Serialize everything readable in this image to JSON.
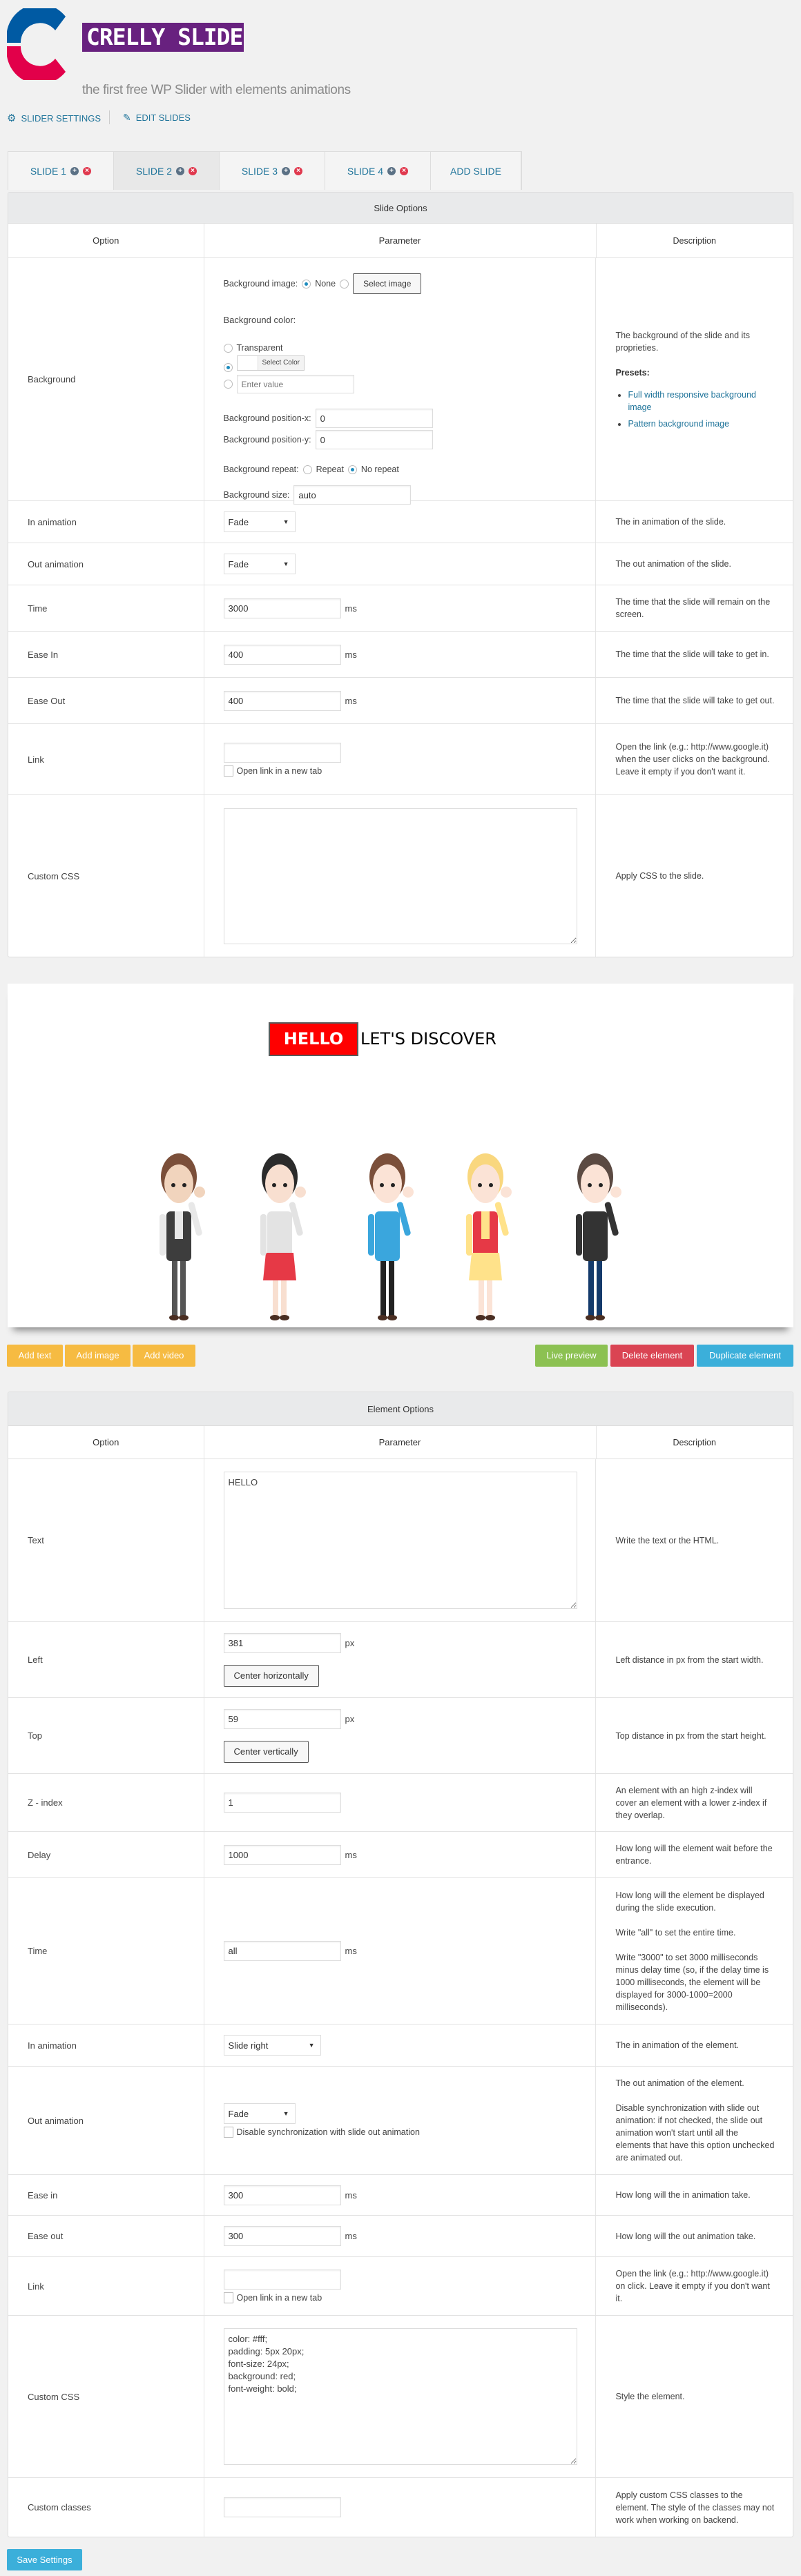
{
  "header": {
    "logo_text": "CRELLY SLIDER",
    "subtitle": "the first free WP Slider with elements animations"
  },
  "nav": {
    "slider_settings": "SLIDER SETTINGS",
    "edit_slides": "EDIT SLIDES"
  },
  "tabs": [
    {
      "label": "SLIDE 1",
      "active": false
    },
    {
      "label": "SLIDE 2",
      "active": true
    },
    {
      "label": "SLIDE 3",
      "active": false
    },
    {
      "label": "SLIDE 4",
      "active": false
    }
  ],
  "add_slide": "ADD SLIDE",
  "columns": {
    "option": "Option",
    "parameter": "Parameter",
    "description": "Description"
  },
  "slide_options": {
    "title": "Slide Options",
    "background": {
      "label": "Background",
      "bg_image_label": "Background image:",
      "none": "None",
      "select_image": "Select image",
      "bg_color_label": "Background color:",
      "transparent": "Transparent",
      "select_color": "Select Color",
      "enter_value_placeholder": "Enter value",
      "pos_x_label": "Background position-x:",
      "pos_x": "0",
      "pos_y_label": "Background position-y:",
      "pos_y": "0",
      "repeat_label": "Background repeat:",
      "repeat": "Repeat",
      "no_repeat": "No repeat",
      "size_label": "Background size:",
      "size": "auto",
      "description": "The background of the slide and its proprieties.",
      "presets_label": "Presets:",
      "presets": [
        "Full width responsive background image",
        "Pattern background image"
      ]
    },
    "rows": [
      {
        "label": "In animation",
        "kind": "select",
        "value": "Fade",
        "description": "The in animation of the slide."
      },
      {
        "label": "Out animation",
        "kind": "select",
        "value": "Fade",
        "description": "The out animation of the slide."
      },
      {
        "label": "Time",
        "kind": "input",
        "value": "3000",
        "unit": "ms",
        "description": "The time that the slide will remain on the screen."
      },
      {
        "label": "Ease In",
        "kind": "input",
        "value": "400",
        "unit": "ms",
        "description": "The time that the slide will take to get in."
      },
      {
        "label": "Ease Out",
        "kind": "input",
        "value": "400",
        "unit": "ms",
        "description": "The time that the slide will take to get out."
      },
      {
        "label": "Link",
        "kind": "link",
        "value": "",
        "checkbox": "Open link in a new tab",
        "description": "Open the link (e.g.: http://www.google.it) when the user clicks on the background. Leave it empty if you don't want it."
      },
      {
        "label": "Custom CSS",
        "kind": "textarea",
        "value": "",
        "description": "Apply CSS to the slide."
      }
    ]
  },
  "preview": {
    "hello": "HELLO",
    "discover": "LET'S DISCOVER"
  },
  "actions": {
    "add_text": "Add text",
    "add_image": "Add image",
    "add_video": "Add video",
    "live_preview": "Live preview",
    "delete_element": "Delete element",
    "duplicate_element": "Duplicate element"
  },
  "colors": {
    "accent": "#21759b",
    "logo_purple": "#68217f",
    "add": "#f6bb42",
    "live": "#8cc152",
    "delete": "#da4453",
    "duplicate": "#3bafda"
  },
  "element_options": {
    "title": "Element Options",
    "rows": [
      {
        "label": "Text",
        "kind": "textarea",
        "value": "HELLO",
        "description": "Write the text or the HTML."
      },
      {
        "label": "Left",
        "kind": "input",
        "value": "381",
        "unit": "px",
        "button": "Center horizontally",
        "description": "Left distance in px from the start width."
      },
      {
        "label": "Top",
        "kind": "input",
        "value": "59",
        "unit": "px",
        "button": "Center vertically",
        "description": "Top distance in px from the start height."
      },
      {
        "label": "Z - index",
        "kind": "input",
        "value": "1",
        "description": "An element with an high z-index will cover an element with a lower z-index if they overlap."
      },
      {
        "label": "Delay",
        "kind": "input",
        "value": "1000",
        "unit": "ms",
        "description": "How long will the element wait before the entrance."
      },
      {
        "label": "Time",
        "kind": "input",
        "value": "all",
        "unit": "ms",
        "description": [
          "How long will the element be displayed during the slide execution.",
          "Write \"all\" to set the entire time.",
          "Write \"3000\" to set 3000 milliseconds minus delay time (so, if the delay time is 1000 milliseconds, the element will be displayed for 3000-1000=2000 milliseconds)."
        ]
      },
      {
        "label": "In animation",
        "kind": "select",
        "value": "Slide right",
        "description": "The in animation of the element."
      },
      {
        "label": "Out animation",
        "kind": "select",
        "value": "Fade",
        "checkbox": "Disable synchronization with slide out animation",
        "description": [
          "The out animation of the element.",
          "Disable synchronization with slide out animation: if not checked, the slide out animation won't start until all the elements that have this option unchecked are animated out."
        ]
      },
      {
        "label": "Ease in",
        "kind": "input",
        "value": "300",
        "unit": "ms",
        "description": "How long will the in animation take."
      },
      {
        "label": "Ease out",
        "kind": "input",
        "value": "300",
        "unit": "ms",
        "description": "How long will the out animation take."
      },
      {
        "label": "Link",
        "kind": "link",
        "value": "",
        "checkbox": "Open link in a new tab",
        "description": "Open the link (e.g.: http://www.google.it) on click. Leave it empty if you don't want it."
      },
      {
        "label": "Custom CSS",
        "kind": "textarea",
        "value": "color: #fff;\npadding: 5px 20px;\nfont-size: 24px;\nbackground: red;\nfont-weight: bold;",
        "description": "Style the element."
      },
      {
        "label": "Custom classes",
        "kind": "input",
        "value": "",
        "description": "Apply custom CSS classes to the element. The style of the classes may not work when working on backend."
      }
    ]
  },
  "save_label": "Save Settings"
}
